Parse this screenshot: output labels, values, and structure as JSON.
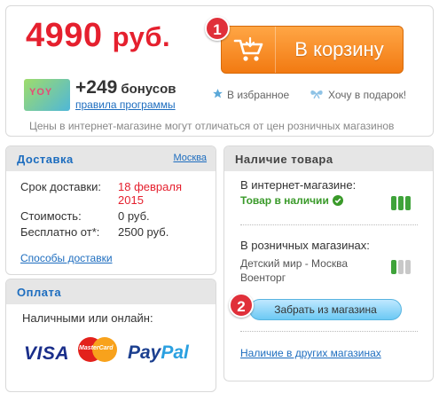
{
  "price": {
    "value": "4990",
    "currency": "руб."
  },
  "markers": {
    "first": "1",
    "second": "2"
  },
  "cart_button": {
    "label": "В корзину",
    "icon": "cart-icon"
  },
  "bonus": {
    "card_logo": "YOY",
    "value": "+249",
    "word": "бонусов",
    "rules_link": "правила программы"
  },
  "actions": {
    "favorites": "В избранное",
    "favorites_icon": "star-icon",
    "gift": "Хочу в подарок!",
    "gift_icon": "gift-bow-icon"
  },
  "price_note": "Цены в интернет-магазине могут отличаться от цен розничных магазинов",
  "delivery": {
    "title": "Доставка",
    "city": "Москва",
    "rows": [
      {
        "key": "Срок доставки:",
        "value": "18 февраля 2015"
      },
      {
        "key": "Стоимость:",
        "value": "0 руб."
      },
      {
        "key": "Бесплатно от*:",
        "value": "2500 руб."
      }
    ],
    "methods_link": "Способы доставки"
  },
  "payment": {
    "title": "Оплата",
    "text": "Наличными или онлайн:",
    "visa": "VISA",
    "mastercard": "MasterCard",
    "paypal_1": "Pay",
    "paypal_2": "Pal"
  },
  "availability": {
    "title": "Наличие товара",
    "online_label": "В интернет-магазине:",
    "online_status": "Товар в наличии",
    "online_level": 3,
    "retail_label": "В розничных магазинах:",
    "store_line1": "Детский мир - Москва",
    "store_line2": "Военторг",
    "retail_level": 1,
    "pickup_button": "Забрать из магазина",
    "other_stores_link": "Наличие в других магазинах"
  },
  "colors": {
    "price_red": "#e5202e",
    "cart_orange": "#f27a12",
    "link_blue": "#1d6dbf",
    "stock_green": "#3a9a2a",
    "pickup_blue": "#6cc9f4"
  }
}
